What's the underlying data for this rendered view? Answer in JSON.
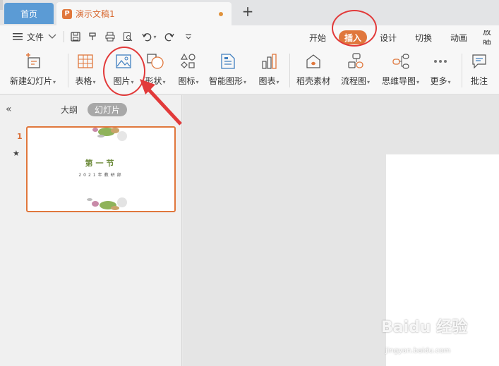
{
  "tabs": {
    "home_label": "首页",
    "doc_icon_letter": "P",
    "doc_title": "演示文稿1",
    "add_tab": "+"
  },
  "menu": {
    "file_label": "文件",
    "file_icon": "hamburger-icon",
    "ribbon_tabs": [
      "开始",
      "插入",
      "设计",
      "切换",
      "动画",
      "放映"
    ],
    "active_tab": "插入"
  },
  "toolbar": {
    "items": [
      {
        "label": "新建幻灯片",
        "icon": "new-slide-icon",
        "dropdown": true
      },
      {
        "label": "表格",
        "icon": "table-icon",
        "dropdown": true
      },
      {
        "label": "图片",
        "icon": "picture-icon",
        "dropdown": true
      },
      {
        "label": "形状",
        "icon": "shape-icon",
        "dropdown": true
      },
      {
        "label": "图标",
        "icon": "icons-icon",
        "dropdown": true
      },
      {
        "label": "智能图形",
        "icon": "smart-graphic-icon",
        "dropdown": true
      },
      {
        "label": "图表",
        "icon": "chart-icon",
        "dropdown": true
      },
      {
        "label": "稻壳素材",
        "icon": "docer-material-icon",
        "dropdown": false
      },
      {
        "label": "流程图",
        "icon": "flowchart-icon",
        "dropdown": true
      },
      {
        "label": "思维导图",
        "icon": "mindmap-icon",
        "dropdown": true
      },
      {
        "label": "更多",
        "icon": "more-icon",
        "dropdown": true
      },
      {
        "label": "批注",
        "icon": "comment-icon",
        "dropdown": false
      }
    ]
  },
  "leftpanel": {
    "collapse": "«",
    "outline_tab": "大纲",
    "slides_tab": "幻灯片",
    "slides": [
      {
        "number": "1",
        "title": "第一节",
        "subtitle": "2021年教研部"
      }
    ]
  },
  "watermark": {
    "brand": "Baidu 经验",
    "url": "jingyan.baidu.com"
  },
  "colors": {
    "accent": "#e0773c",
    "home_tab": "#5b9bd5",
    "annotation": "#e23a3a"
  }
}
